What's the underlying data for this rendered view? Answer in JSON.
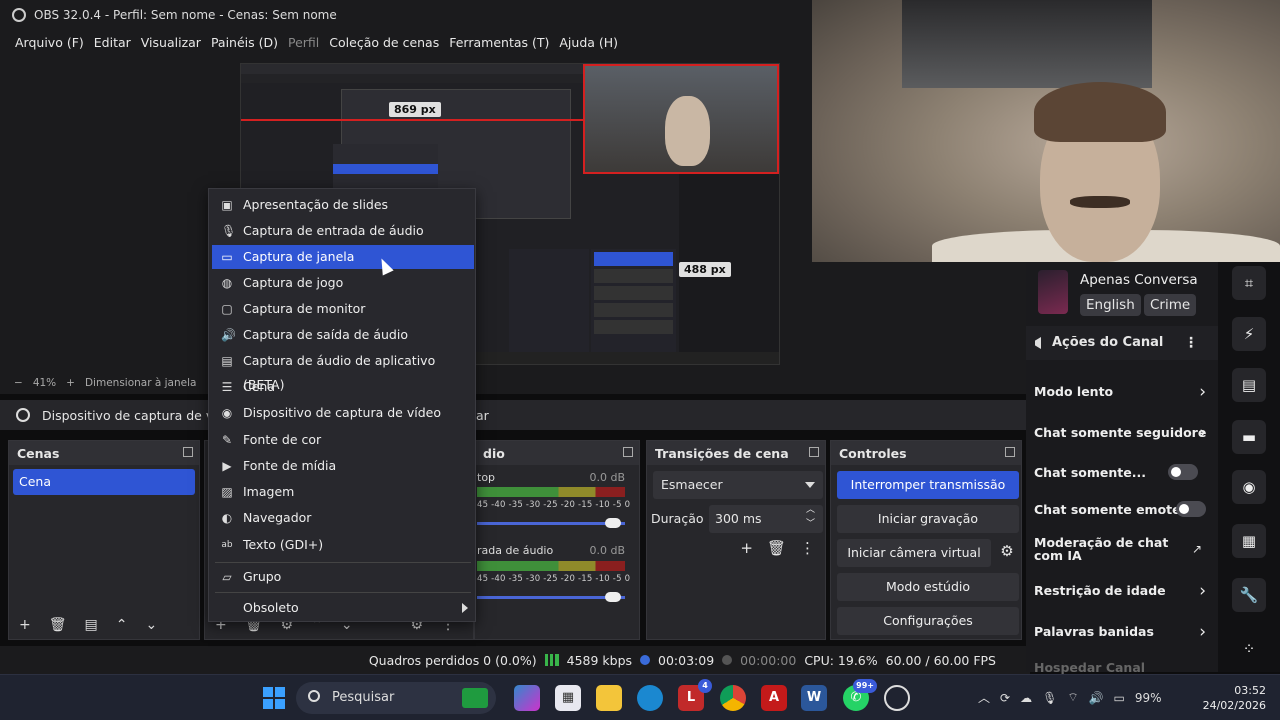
{
  "window": {
    "title": "OBS 32.0.4 - Perfil: Sem nome - Cenas: Sem nome"
  },
  "menu": [
    "Arquivo (F)",
    "Editar",
    "Visualizar",
    "Painéis (D)",
    "Perfil",
    "Coleção de cenas",
    "Ferramentas (T)",
    "Ajuda (H)"
  ],
  "preview": {
    "badge_top": "869 px",
    "badge_mid": "488 px"
  },
  "zoombar": {
    "minus": "−",
    "zoom": "41%",
    "plus": "+",
    "label": "Dimensionar à janela"
  },
  "sourcebar": {
    "label": "Dispositivo de captura de v",
    "right_fragment": "ar"
  },
  "context_menu": {
    "items": [
      {
        "label": "Apresentação de slides",
        "icon": "slideshow-icon",
        "glyph": "▣"
      },
      {
        "label": "Captura de entrada de áudio",
        "icon": "microphone-icon",
        "glyph": "🎙"
      },
      {
        "label": "Captura de janela",
        "icon": "window-icon",
        "glyph": "▭",
        "selected": true
      },
      {
        "label": "Captura de jogo",
        "icon": "gamepad-icon",
        "glyph": "◍"
      },
      {
        "label": "Captura de monitor",
        "icon": "monitor-icon",
        "glyph": "▢"
      },
      {
        "label": "Captura de saída de áudio",
        "icon": "speaker-icon",
        "glyph": "🔊"
      },
      {
        "label": "Captura de áudio de aplicativo (BETA)",
        "icon": "app-audio-icon",
        "glyph": "▤"
      },
      {
        "label": "Cena",
        "icon": "list-icon",
        "glyph": "☰"
      },
      {
        "label": "Dispositivo de captura de vídeo",
        "icon": "camera-icon",
        "glyph": "◉"
      },
      {
        "label": "Fonte de cor",
        "icon": "brush-icon",
        "glyph": "✎"
      },
      {
        "label": "Fonte de mídia",
        "icon": "play-icon",
        "glyph": "▶"
      },
      {
        "label": "Imagem",
        "icon": "image-icon",
        "glyph": "▨"
      },
      {
        "label": "Navegador",
        "icon": "globe-icon",
        "glyph": "◐"
      },
      {
        "label": "Texto (GDI+)",
        "icon": "text-icon",
        "glyph": "ab"
      },
      {
        "label": "Grupo",
        "icon": "folder-icon",
        "glyph": "▱"
      },
      {
        "label": "Obsoleto",
        "icon": "",
        "glyph": "",
        "submenu": true
      }
    ]
  },
  "scenes": {
    "title": "Cenas",
    "items": [
      "Cena"
    ]
  },
  "audio": {
    "title": "dio",
    "channels": [
      {
        "name": "top",
        "db": "0.0 dB"
      },
      {
        "name": "rada de áudio",
        "db": "0.0 dB"
      }
    ],
    "scale": "45 -40 -35 -30 -25 -20 -15 -10 -5 0"
  },
  "transitions": {
    "title": "Transições de cena",
    "selected": "Esmaecer",
    "duration_label": "Duração",
    "duration_value": "300 ms"
  },
  "controls": {
    "title": "Controles",
    "buttons": [
      "Interromper transmissão",
      "Iniciar gravação",
      "Iniciar câmera virtual",
      "Modo estúdio",
      "Configurações"
    ]
  },
  "status": {
    "dropped": "Quadros perdidos 0 (0.0%)",
    "bitrate": "4589 kbps",
    "stream_time": "00:03:09",
    "rec_time": "00:00:00",
    "cpu": "CPU: 19.6%",
    "fps": "60.00 / 60.00 FPS"
  },
  "channel": {
    "name": "Apenas Conversa",
    "tags": [
      "English",
      "Crime"
    ]
  },
  "actions": {
    "title": "Ações do Canal",
    "items": [
      {
        "label": "Modo lento",
        "type": "chevron"
      },
      {
        "label": "Chat somente seguidore",
        "type": "chevron"
      },
      {
        "label": "Chat somente...",
        "type": "toggle"
      },
      {
        "label": "Chat somente emotes",
        "type": "toggle"
      },
      {
        "label": "Moderação de chat com IA",
        "type": "external"
      },
      {
        "label": "Restrição de idade",
        "type": "chevron"
      },
      {
        "label": "Palavras banidas",
        "type": "chevron"
      },
      {
        "label": "Hospedar Canal",
        "type": "none"
      }
    ]
  },
  "taskbar": {
    "search": "Pesquisar",
    "badge_mail": "4",
    "badge_chat": "99+",
    "battery": "99%",
    "time": "03:52",
    "date": "24/02/2026"
  },
  "colors": {
    "accent": "#2f55d4",
    "panel": "#27272b",
    "background": "#1b1b1d"
  }
}
